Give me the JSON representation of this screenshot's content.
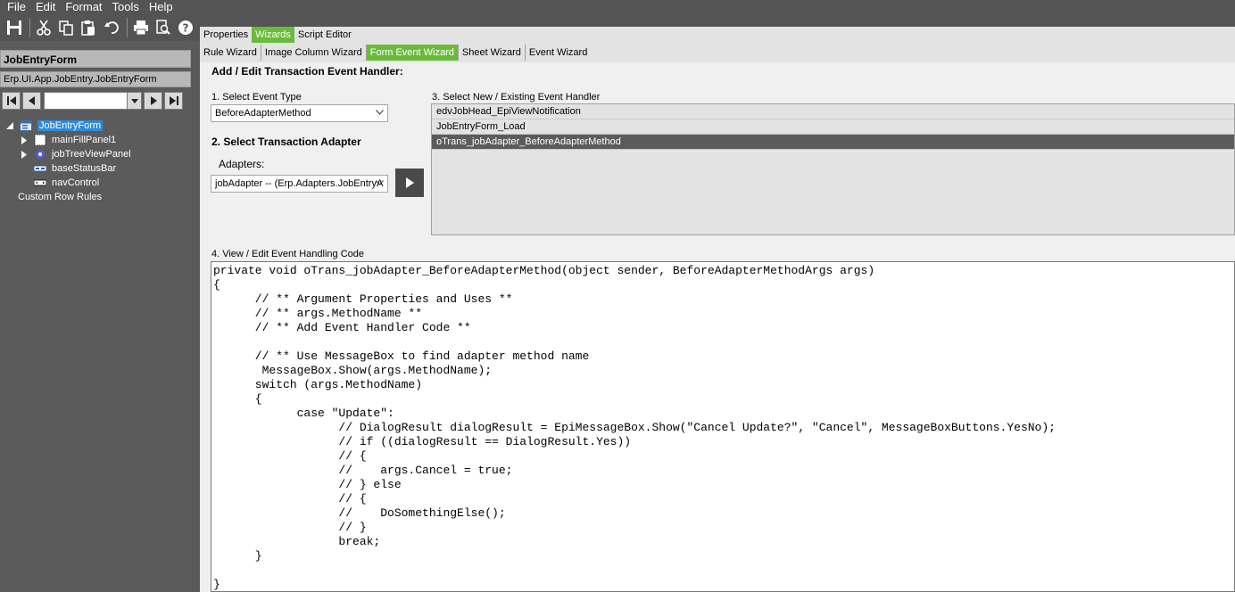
{
  "menu": [
    "File",
    "Edit",
    "Format",
    "Tools",
    "Help"
  ],
  "toolbar": {
    "icons": [
      "save-icon",
      "cut-icon",
      "copy-icon",
      "paste-icon",
      "undo-icon",
      "print-icon",
      "print-preview-icon",
      "help-icon"
    ]
  },
  "left_panel": {
    "form_title": "JobEntryForm",
    "form_path": "Erp.UI.App.JobEntry.JobEntryForm",
    "nav_value": "",
    "tree": [
      {
        "label": "JobEntryForm",
        "selected": true
      },
      {
        "label": "mainFillPanel1"
      },
      {
        "label": "jobTreeViewPanel"
      },
      {
        "label": "baseStatusBar"
      },
      {
        "label": "navControl"
      },
      {
        "label": "Custom Row Rules"
      }
    ]
  },
  "tabs_top": [
    {
      "label": "Properties",
      "active": false
    },
    {
      "label": "Wizards",
      "active": true
    },
    {
      "label": "Script Editor",
      "active": false
    }
  ],
  "tabs_wizard": [
    {
      "label": "Rule Wizard",
      "active": false
    },
    {
      "label": "Image Column Wizard",
      "active": false
    },
    {
      "label": "Form Event Wizard",
      "active": true
    },
    {
      "label": "Sheet Wizard",
      "active": false
    },
    {
      "label": "Event Wizard",
      "active": false
    }
  ],
  "wizard": {
    "heading": "Add / Edit Transaction Event Handler:",
    "step1_label": "1. Select Event Type",
    "event_type": "BeforeAdapterMethod",
    "step2_label": "2. Select Transaction Adapter",
    "adapters_label": "Adapters:",
    "adapter_value": "jobAdapter -- (Erp.Adapters.JobEntryA",
    "step3_label": "3. Select New / Existing Event Handler",
    "handlers": [
      {
        "label": "edvJobHead_EpiViewNotification",
        "selected": false
      },
      {
        "label": "JobEntryForm_Load",
        "selected": false
      },
      {
        "label": "oTrans_jobAdapter_BeforeAdapterMethod",
        "selected": true
      }
    ],
    "step4_label": "4. View / Edit Event Handling Code",
    "code": "private void oTrans_jobAdapter_BeforeAdapterMethod(object sender, BeforeAdapterMethodArgs args)\n{\n      // ** Argument Properties and Uses **\n      // ** args.MethodName **\n      // ** Add Event Handler Code **\n\n      // ** Use MessageBox to find adapter method name\n       MessageBox.Show(args.MethodName);\n      switch (args.MethodName)\n      {\n            case \"Update\":\n                  // DialogResult dialogResult = EpiMessageBox.Show(\"Cancel Update?\", \"Cancel\", MessageBoxButtons.YesNo);\n                  // if ((dialogResult == DialogResult.Yes))\n                  // {\n                  //    args.Cancel = true;\n                  // } else\n                  // {\n                  //    DoSomethingElse();\n                  // }\n                  break;\n      }\n\n}"
  }
}
